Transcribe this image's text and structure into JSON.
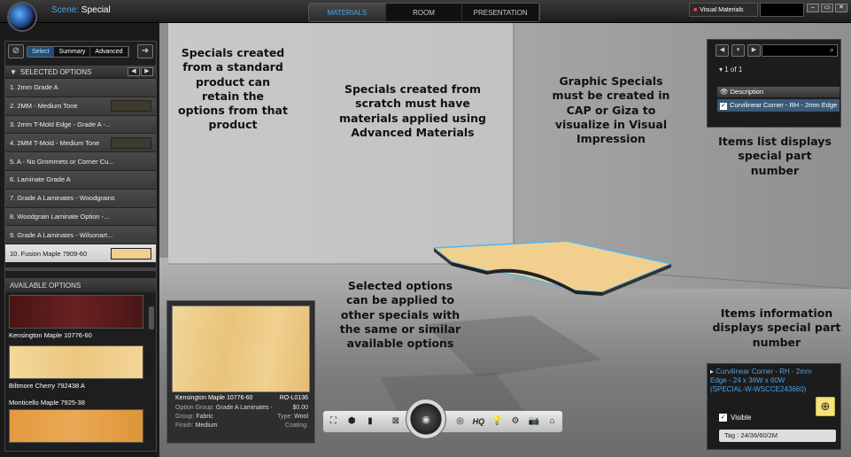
{
  "header": {
    "scene_label": "Scene:",
    "scene_name": "Special",
    "tabs": [
      "MATERIALS",
      "ROOM",
      "PRESENTATION"
    ],
    "visual_materials": "Visual Materials",
    "window_buttons": [
      "–",
      "▭",
      "✕"
    ]
  },
  "left_panel": {
    "modes": [
      "Select",
      "Summary",
      "Advanced"
    ],
    "selected_header": "SELECTED OPTIONS",
    "selected_options": [
      {
        "label": "1.  2mm Grade A",
        "swatch": ""
      },
      {
        "label": "2.  2MM - Medium Tone",
        "swatch": "#3f3a2e"
      },
      {
        "label": "3.  2mm T-Mold Edge - Grade A -...",
        "swatch": ""
      },
      {
        "label": "4.  2MM T-Mold - Medium Tone",
        "swatch": "#3f3a2e"
      },
      {
        "label": "5.  A - No Grommets or Corner Cu...",
        "swatch": ""
      },
      {
        "label": "6.  Laminate Grade A",
        "swatch": ""
      },
      {
        "label": "7.  Grade A Laminates - Woodgrains",
        "swatch": ""
      },
      {
        "label": "8.  Woodgrain Laminate Option -...",
        "swatch": ""
      },
      {
        "label": "9.  Grade A Laminates - Wilsonart...",
        "swatch": ""
      },
      {
        "label": "10.  Fusion Maple 7909-60",
        "swatch": "#f1cf8e",
        "selected": true
      }
    ],
    "available_header": "AVAILABLE OPTIONS",
    "available_options": [
      {
        "label": "Kensington Maple 10776-60",
        "color": "#5a1c1c"
      },
      {
        "label": "Biltmore Cherry 792438 A",
        "color": "#f0d090"
      },
      {
        "label": "Monticello Maple 7925-38",
        "color": "#e6a24a"
      }
    ]
  },
  "popup": {
    "name": "Kensington Maple 10776-60",
    "code": "RO-L0136",
    "group_label": "Option Group:",
    "group_value": "Grade A Laminates -",
    "price": "$0.00",
    "group2_label": "Group:",
    "group2_value": "Fabric",
    "type_label": "Type:",
    "type_value": "Wool",
    "finish_label": "Finish:",
    "finish_value": "Medium",
    "coating_label": "Coating:"
  },
  "right_top": {
    "pager": "1 of 1",
    "column": "Description",
    "item": "Curvilinear Corner - RH - 2mm Edge -"
  },
  "right_bottom": {
    "item_title": "Curvilinear Corner - RH - 2mm Edge - 24 x 36W x 60W (SPECIAL-W-WSCCE243660)",
    "visible_label": "Visible",
    "tag": "Tag : 24/36/60/2M"
  },
  "toolbar": {
    "hq": "HQ"
  },
  "callouts": {
    "c1": "Specials created from a standard product can retain the options from that product",
    "c2": "Specials created from scratch must have materials applied using Advanced Materials",
    "c3": "Graphic Specials must be created in CAP or Giza to visualize in Visual Impression",
    "c4": "Items list displays special part number",
    "c5": "Selected options can be applied to other specials with the same or similar available options",
    "c6": "Items information displays special part number"
  }
}
